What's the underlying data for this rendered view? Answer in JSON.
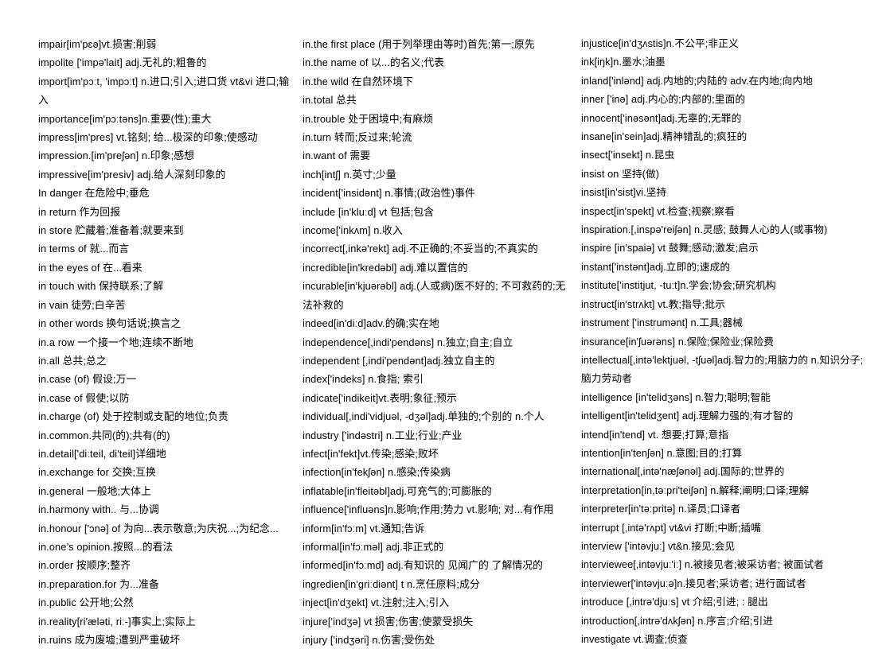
{
  "document": {
    "title": "English Vocabulary List — im / in",
    "background_color": "#ffffff",
    "text_color": "#000000",
    "column_count": 3
  },
  "columns": [
    {
      "id": "column-1",
      "entries": [
        "impair[im'pɛə]vt.损害;削弱",
        "impolite ['impə'lait] adj.无礼的;粗鲁的",
        "import[im'pɔːt, 'impɔːt] n.进口;引入;进口货 vt&vi 进口;输入",
        "importance[im'pɔːtəns]n.重要(性);重大",
        "impress[im'pres] vt.铭刻; 给...极深的印象;使感动",
        "impression.[im'preʃən] n.印象;感想",
        "impressive[im'presiv] adj.给人深刻印象的",
        "In danger 在危险中;垂危",
        "in return 作为回报",
        "in store 贮藏着;准备着;就要来到",
        "in terms of 就...而言",
        "in the eyes of 在...看来",
        "in touch with 保持联系;了解",
        "in vain 徒劳;白辛苦",
        "in other words 换句话说;换言之",
        "in.a row 一个接一个地;连续不断地",
        "in.all 总共;总之",
        "in.case (of) 假设;万一",
        "in.case of 假使;以防",
        "in.charge (of) 处于控制或支配的地位;负责",
        "in.common.共同(的);共有(的)",
        "in.detail['diːteil, di'teil]详细地",
        "in.exchange for 交换;互换",
        "in.general 一般地;大体上",
        "in.harmony with.. 与...协调",
        "in.honour ['ɔnə] of 为向...表示敬意;为庆祝...;为纪念...",
        "in.one’s opinion.按照...的看法",
        "in.order 按顺序;整齐",
        "in.preparation.for 为...准备",
        "in.public 公开地;公然",
        "in.reality[ri'æləti, riː-]事实上;实际上",
        "in.ruins 成为废墟;遭到严重破坏"
      ]
    },
    {
      "id": "column-2",
      "entries": [
        "in.the first place (用于列举理由等时)首先;第一;原先",
        "in.the name of 以...的名义;代表",
        "in.the wild 在自然环境下",
        "in.total 总共",
        "in.trouble 处于困境中;有麻烦",
        "in.turn 转而;反过来;轮流",
        "in.want of 需要",
        "inch[intʃ] n.英寸;少量",
        "incident['insidənt] n.事情;(政治性)事件",
        "include [in'kluːd] vt 包括;包含",
        "income['inkʌm] n.收入",
        "incorrect[,inkə'rekt] adj.不正确的;不妥当的;不真实的",
        "incredible[in'kredəbl] adj.难以置信的",
        "incurable[in'kjuərəbl] adj.(人或病)医不好的; 不可救药的;无法补救的",
        "indeed[in'diːd]adv.的确;实在地",
        "independence[,indi'pendəns] n.独立;自主;自立",
        "independent [,indi'pendənt]adj.独立自主的",
        "index['indeks] n.食指; 索引",
        "indicate['indikeit]vt.表明;象征;预示",
        "individual[,indi'vidjuəl, -dʒəl]adj.单独的;个别的 n.个人",
        "industry ['indəstri] n.工业;行业;产业",
        "infect[in'fekt]vt.传染;感染;败坏",
        "infection[in'fekʃən] n.感染;传染病",
        "inflatable[in'fleitəbl]adj.可充气的;可膨胀的",
        "influence['influəns]n.影响;作用;势力 vt.影响; 对...有作用",
        "inform[in'fɔːm] vt.通知;告诉",
        "informal[in'fɔːməl] adj.非正式的",
        "informed[in'fɔːmd] adj.有知识的 见闻广的 了解情况的",
        "ingredien[in'griːdiənt] t n.烹任原料;成分",
        "inject[in'dʒekt] vt.注射;注入;引入",
        "injure['indʒə] vt 损害;伤害;使蒙受损失",
        "injury ['indʒəri] n.伤害;受伤处"
      ]
    },
    {
      "id": "column-3",
      "entries": [
        "injustice[in'dʒʌstis]n.不公平;非正义",
        "ink[iŋk]n.墨水;油墨",
        "inland['inlənd] adj.内地的;内陆的 adv.在内地;向内地",
        "inner ['inə] adj.内心的;内部的;里面的",
        "innocent['inəsənt]adj.无辜的;无罪的",
        "insane[in'sein]adj.精神错乱的;疯狂的",
        "insect['insekt] n.昆虫",
        "insist on 坚持(做)",
        "insist[in'sist]vi.坚持",
        "inspect[in'spekt] vt.检查;视察;察看",
        "inspiration.[,inspə'reiʃən] n.灵感; 鼓舞人心的人(或事物)",
        "inspire [in'spaiə] vt 鼓舞;感动;激发;启示",
        "instant['instənt]adj.立即的;速成的",
        "institute['institjut, -tuːt]n.学会;协会;研究机构",
        "instruct[in'strʌkt] vt.教;指导;批示",
        "instrument ['instrumənt] n.工具;器械",
        "insurance[in'ʃuərəns] n.保险;保险业;保险费",
        "intellectual[,intə'lektjuəl, -tʃuəl]adj.智力的;用脑力的 n.知识分子;脑力劳动者",
        "intelligence [in'telidʒəns] n.智力;聪明;智能",
        "intelligent[in'telidʒent] adj.理解力强的;有才智的",
        "intend[in'tend] vt. 想要;打算;意指",
        "intention[in'tenʃən] n.意图;目的;打算",
        "international[,intə'næʃənəl] adj.国际的;世界的",
        "interpretation[in,təːpri'teiʃən] n.解释;阐明;口译;理解",
        "interpreter[in'təːpritə] n.译员;口译者",
        "interrupt [,intə'rʌpt] vt&vi 打断;中断;插嘴",
        "interview ['intəvjuː] vt&n.接见;会见",
        "interviewee[,intəvjuː'iː] n.被接见者;被采访者; 被面试者",
        "interviewer['intəvjuːə]n.接见者;采访者; 进行面试者",
        "introduce [,intrə'djuːs] vt 介绍;引进; : 腿出",
        "introduction[,intrə'dʌkʃən] n.序言;介绍;引进",
        "investigate vt.调查;侦查"
      ]
    }
  ]
}
